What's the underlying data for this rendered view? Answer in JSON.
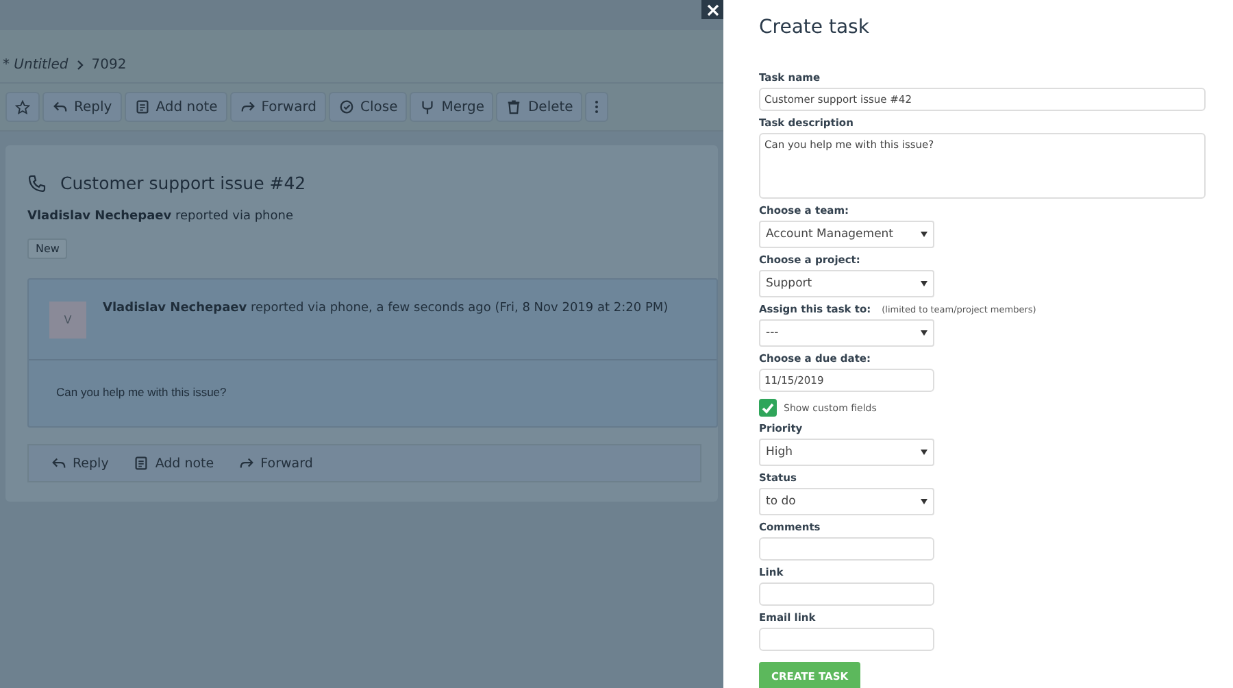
{
  "breadcrumb": [
    "* Untitled",
    "7092"
  ],
  "toolbar": [
    {
      "label": "Reply",
      "kind": "reply"
    },
    {
      "label": "Add note",
      "kind": "note"
    },
    {
      "label": "Forward",
      "kind": "forward"
    },
    {
      "label": "Close",
      "kind": "check"
    },
    {
      "label": "Merge",
      "kind": "merge"
    },
    {
      "label": "Delete",
      "kind": "trash"
    }
  ],
  "ticket": {
    "title": "Customer support issue #42",
    "reporter": "Vladislav Nechepaev",
    "reported": "reported via phone",
    "status_tag": "New",
    "message": {
      "avatar": "V",
      "author": "Vladislav Nechepaev",
      "meta": "reported via phone, a few seconds ago (Fri, 8 Nov 2019 at 2:20 PM)",
      "body": "Can you help me with this issue?"
    },
    "actions": [
      {
        "label": "Reply",
        "kind": "reply"
      },
      {
        "label": "Add note",
        "kind": "note"
      },
      {
        "label": "Forward",
        "kind": "forward"
      }
    ]
  },
  "panel": {
    "title": "Create task",
    "fields": [
      {
        "kind": "text",
        "label": "Task name",
        "value": "Customer support issue #42"
      },
      {
        "kind": "textarea",
        "label": "Task description",
        "value": "Can you help me with this issue?"
      },
      {
        "kind": "select",
        "label": "Choose a team:",
        "value": "Account Management"
      },
      {
        "kind": "select",
        "label": "Choose a project:",
        "value": "Support"
      },
      {
        "kind": "select",
        "label": "Assign this task to:",
        "hint": "(limited to team/project members)",
        "value": "---"
      },
      {
        "kind": "date",
        "label": "Choose a due date:",
        "value": "11/15/2019"
      },
      {
        "kind": "checkbox",
        "label": "Show custom fields",
        "checked": true
      },
      {
        "kind": "select",
        "label": "Priority",
        "value": "High"
      },
      {
        "kind": "select",
        "label": "Status",
        "value": "to do"
      },
      {
        "kind": "text",
        "label": "Comments"
      },
      {
        "kind": "text",
        "label": "Link"
      },
      {
        "kind": "text",
        "label": "Email link"
      }
    ],
    "submit": "CREATE TASK"
  }
}
